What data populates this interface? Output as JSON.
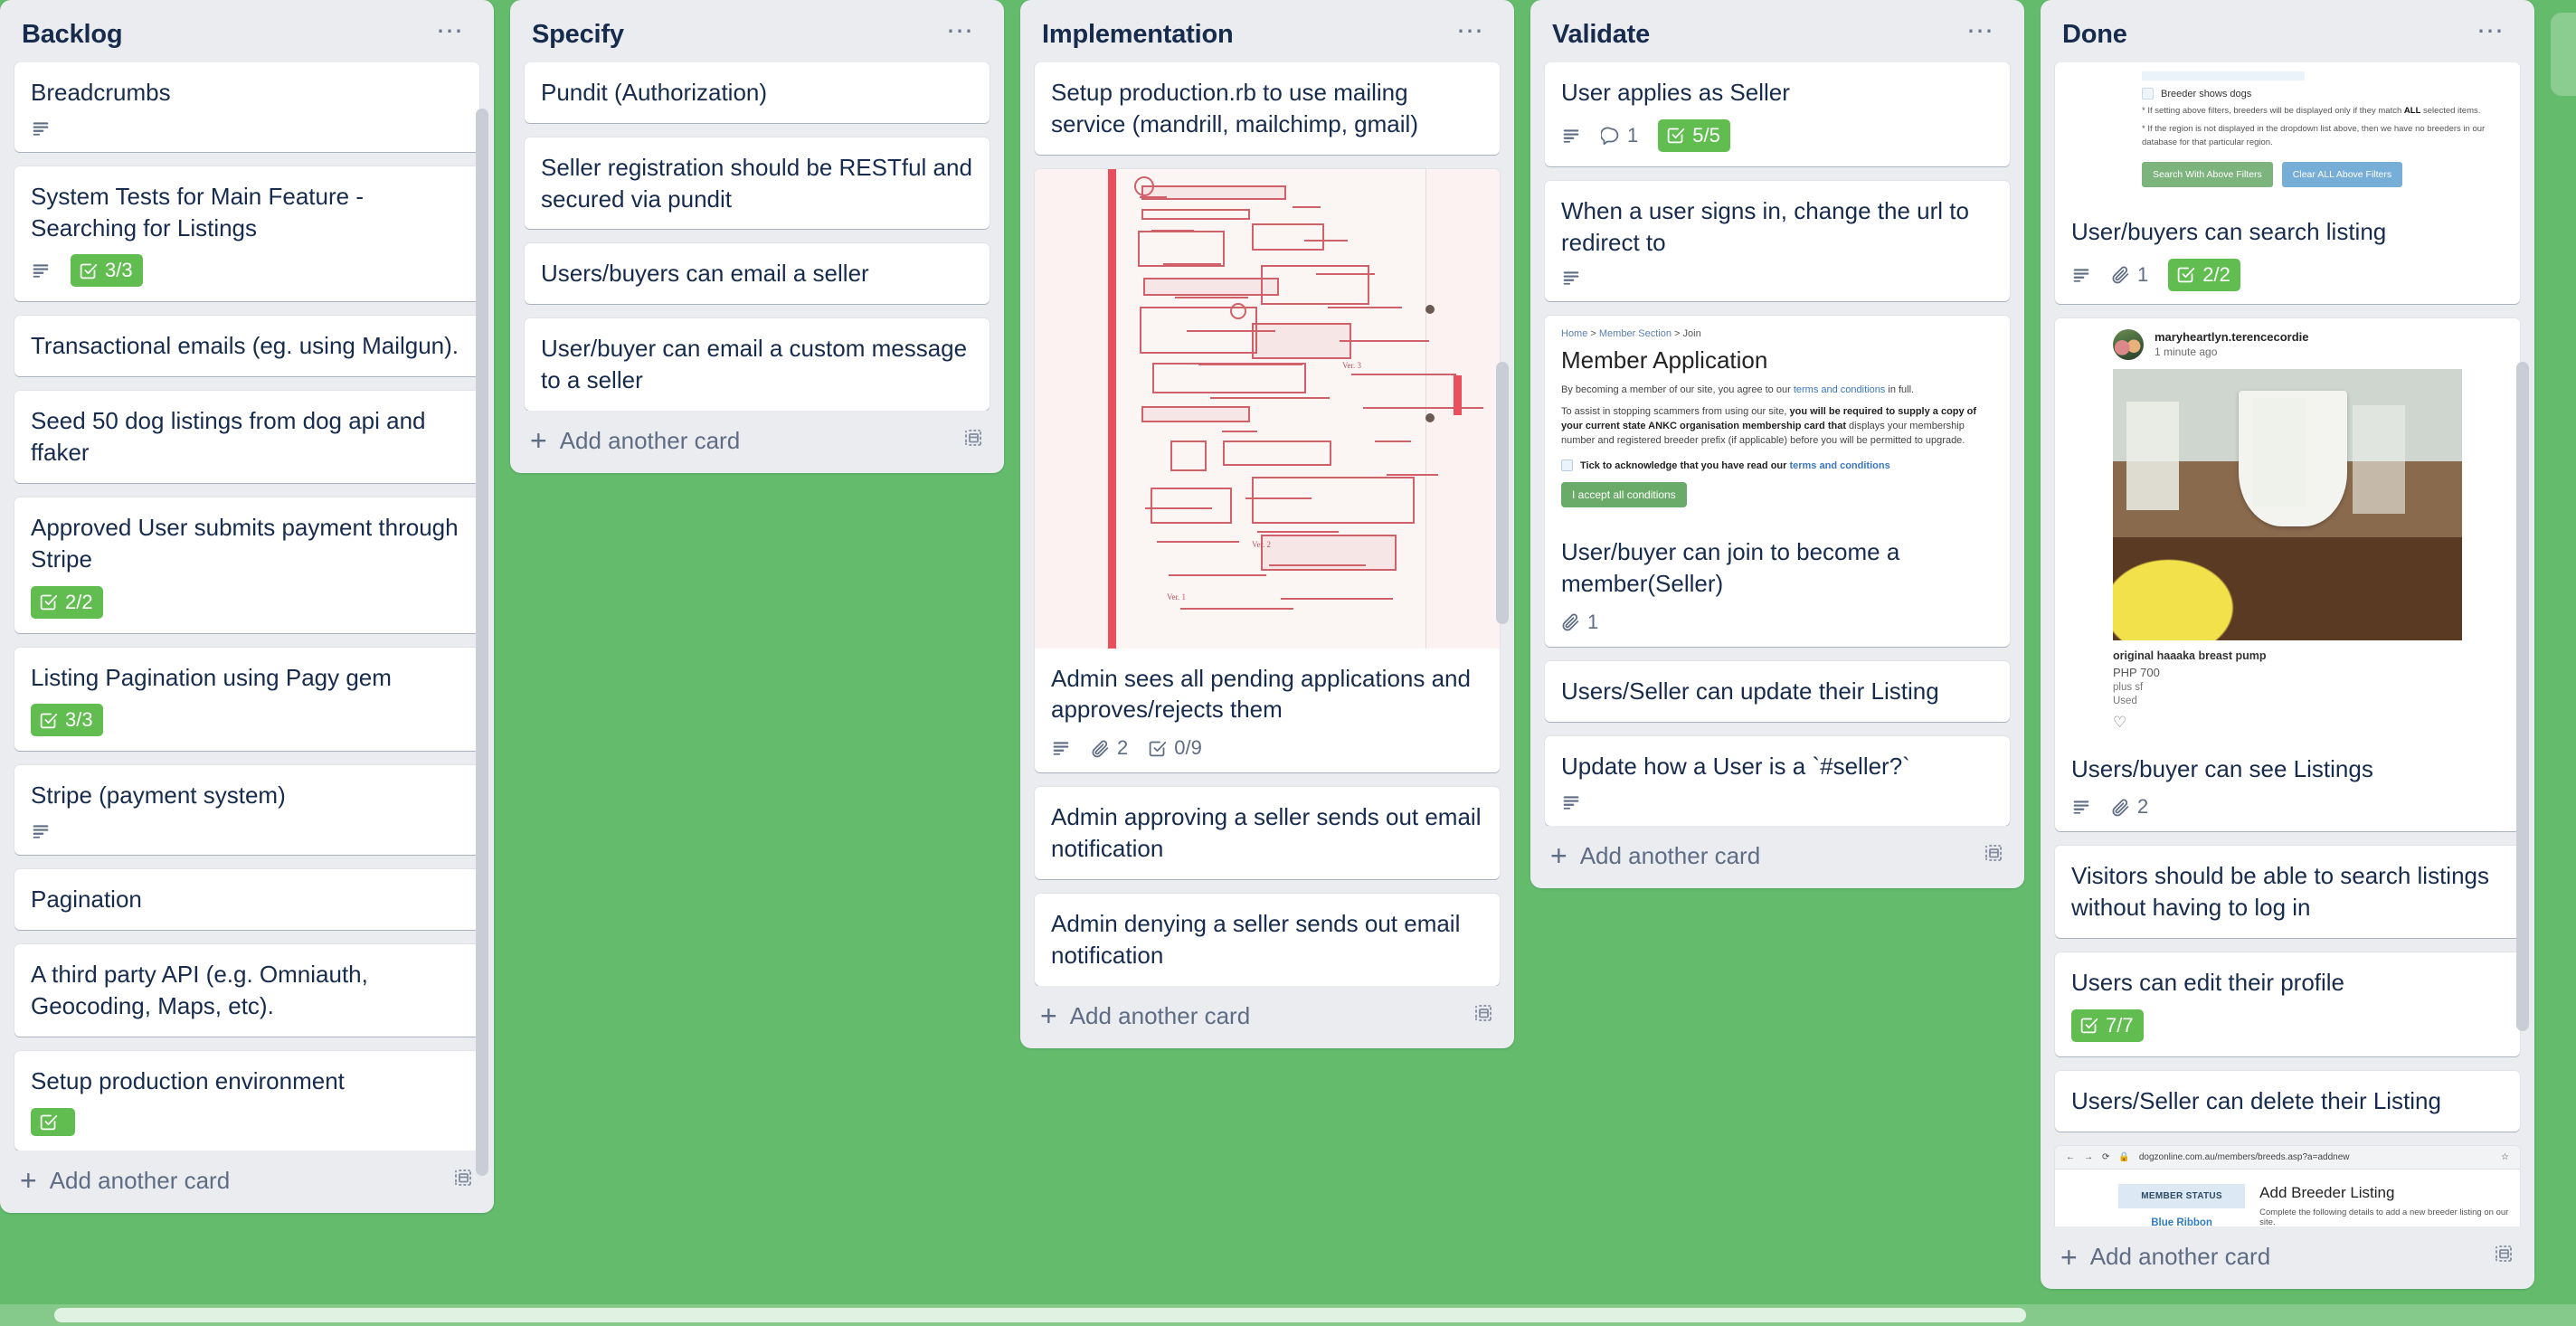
{
  "board": {
    "background_color": "#63bb6b",
    "add_list_label": "+"
  },
  "lists": [
    {
      "title": "Backlog",
      "menu": "⋯",
      "add_card_label": "Add another card",
      "cards": [
        {
          "title": "Breadcrumbs",
          "description": true
        },
        {
          "title": "System Tests for Main Feature - Searching for Listings",
          "description": true,
          "checklist": "3/3",
          "checklist_complete": true
        },
        {
          "title": "Transactional emails (eg. using Mailgun)."
        },
        {
          "title": "Seed 50 dog listings from dog api and ffaker"
        },
        {
          "title": "Approved User submits payment through Stripe",
          "checklist": "2/2",
          "checklist_complete": true
        },
        {
          "title": "Listing Pagination using Pagy gem",
          "checklist": "3/3",
          "checklist_complete": true
        },
        {
          "title": "Stripe (payment system)",
          "description": true
        },
        {
          "title": "Pagination"
        },
        {
          "title": "A third party API (e.g. Omniauth, Geocoding, Maps, etc)."
        },
        {
          "title": "Setup production environment",
          "checklist": "",
          "checklist_complete": true
        }
      ]
    },
    {
      "title": "Specify",
      "menu": "⋯",
      "add_card_label": "Add another card",
      "cards": [
        {
          "title": "Pundit (Authorization)"
        },
        {
          "title": "Seller registration should be RESTful and secured via pundit"
        },
        {
          "title": "Users/buyers can email a seller"
        },
        {
          "title": "User/buyer can email a custom message to a seller"
        }
      ]
    },
    {
      "title": "Implementation",
      "menu": "⋯",
      "add_card_label": "Add another card",
      "cards": [
        {
          "title": "Setup production.rb to use mailing service (mandrill, mailchimp, gmail)"
        },
        {
          "title": "Admin sees all pending applications and approves/rejects them",
          "cover": "sketch",
          "description": true,
          "attachments": "2",
          "checklist": "0/9",
          "checklist_complete": false
        },
        {
          "title": "Admin approving a seller sends out email notification"
        },
        {
          "title": "Admin denying a seller sends out email notification"
        }
      ]
    },
    {
      "title": "Validate",
      "menu": "⋯",
      "add_card_label": "Add another card",
      "cards": [
        {
          "title": "User applies as Seller",
          "description": true,
          "comments": "1",
          "checklist": "5/5",
          "checklist_complete": true
        },
        {
          "title": "When a user signs in, change the url to redirect to",
          "description": true
        },
        {
          "title": "User/buyer can join to become a member(Seller)",
          "cover": "member-application",
          "attachments": "1"
        },
        {
          "title": "Users/Seller can update their Listing"
        },
        {
          "title": "Update how a User is a `#seller?`",
          "description": true
        }
      ]
    },
    {
      "title": "Done",
      "menu": "⋯",
      "add_card_label": "Add another card",
      "cards": [
        {
          "title": "User/buyers can search listing",
          "cover": "breeder-filter",
          "description": true,
          "attachments": "1",
          "checklist": "2/2",
          "checklist_complete": true
        },
        {
          "title": "Users/buyer can see Listings",
          "cover": "photo-post",
          "description": true,
          "attachments": "2"
        },
        {
          "title": "Visitors should be able to search listings without having to log in"
        },
        {
          "title": "Users can edit their profile",
          "checklist": "7/7",
          "checklist_complete": true
        },
        {
          "title": "Users/Seller can delete their Listing"
        },
        {
          "title": "",
          "cover": "browser-breeder"
        }
      ]
    }
  ],
  "covers": {
    "member_application": {
      "breadcrumbs": [
        "Home",
        "Member Section",
        "Join"
      ],
      "breadcrumb_separator": ">",
      "heading": "Member Application",
      "para1_pre": "By becoming a member of our site, you agree to our ",
      "para1_link": "terms and conditions",
      "para1_post": " in full.",
      "para2_pre": "To assist in stopping scammers from using our site, ",
      "para2_bold": "you will be required to supply a copy of your current state ANKC organisation membership card that",
      "para2_post": " displays your membership number and registered breeder prefix (if applicable) before you will be permitted to upgrade.",
      "checkbox_label_pre": "Tick to acknowledge that you have read our ",
      "checkbox_label_link": "terms and conditions",
      "button": "I accept all conditions"
    },
    "breeder_filter": {
      "checkbox_label": "Breeder shows dogs",
      "note1_pre": "* If setting above filters, breeders will be displayed only if they match ",
      "note1_bold": "ALL",
      "note1_post": " selected items.",
      "note2": "* If the region is not displayed in the dropdown list above, then we have no breeders in our database for that particular region.",
      "button_search": "Search With Above Filters",
      "button_clear": "Clear ALL Above Filters"
    },
    "photo_post": {
      "username": "maryheartlyn.terencecordie",
      "timestamp": "1 minute ago",
      "item_title": "original haaaka breast pump",
      "price": "PHP 700",
      "shipping": "plus sf",
      "condition": "Used",
      "like_icon": "♡"
    },
    "browser_breeder": {
      "url": "dogzonline.com.au/members/breeds.asp?a=addnew",
      "sidebar_heading": "MEMBER STATUS",
      "sidebar_value": "Blue Ribbon",
      "heading": "Add Breeder Listing",
      "subtext": "Complete the following details to add a new breeder listing on our site."
    },
    "sketch": {
      "labels": [
        "Ver. 1",
        "Ver. 2",
        "Ver. 3"
      ]
    }
  },
  "colors": {
    "board_green": "#63bb6b",
    "list_bg": "#ebecf0",
    "card_bg": "#ffffff",
    "text": "#172b4d",
    "muted": "#5e6c84",
    "checklist_complete": "#61bd4f"
  }
}
